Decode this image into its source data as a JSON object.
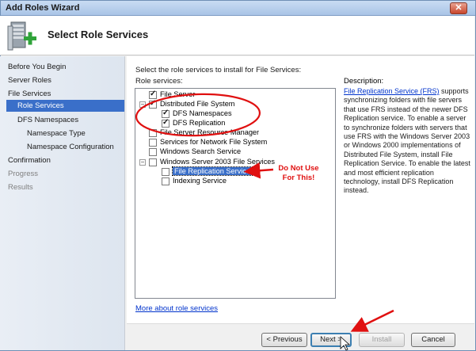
{
  "window": {
    "title": "Add Roles Wizard",
    "close_glyph": "✕"
  },
  "header": {
    "title": "Select Role Services",
    "icon": "server-role-add-icon"
  },
  "sidebar": {
    "items": [
      {
        "label": "Before You Begin"
      },
      {
        "label": "Server Roles"
      },
      {
        "label": "File Services"
      },
      {
        "label": "Role Services",
        "active": true
      },
      {
        "label": "DFS Namespaces"
      },
      {
        "label": "Namespace Type"
      },
      {
        "label": "Namespace Configuration"
      },
      {
        "label": "Confirmation"
      },
      {
        "label": "Progress",
        "disabled": true
      },
      {
        "label": "Results",
        "disabled": true
      }
    ]
  },
  "main": {
    "instruction": "Select the role services to install for File Services:",
    "list_label": "Role services:",
    "tree": [
      {
        "label": "File Server",
        "checked": true
      },
      {
        "label": "Distributed File System",
        "checked": true,
        "expander": "−"
      },
      {
        "label": "DFS Namespaces",
        "checked": true
      },
      {
        "label": "DFS Replication",
        "checked": true
      },
      {
        "label": "File Server Resource Manager",
        "checked": false
      },
      {
        "label": "Services for Network File System",
        "checked": false
      },
      {
        "label": "Windows Search Service",
        "checked": false
      },
      {
        "label": "Windows Server 2003 File Services",
        "checked": false,
        "expander": "−"
      },
      {
        "label": "File Replication Service",
        "checked": false,
        "selected": true
      },
      {
        "label": "Indexing Service",
        "checked": false
      }
    ],
    "description": {
      "title": "Description:",
      "link_text": "File Replication Service (FRS)",
      "body": " supports synchronizing folders with file servers that use FRS instead of the newer DFS Replication service. To enable a server to synchronize folders with servers that use FRS with the Windows Server 2003 or Windows 2000 implementations of Distributed File System, install File Replication Service. To enable the latest and most efficient replication technology, install DFS Replication instead."
    },
    "more_link": "More about role services",
    "annotation": "Do Not Use For This!"
  },
  "footer": {
    "previous": "< Previous",
    "next": "Next >",
    "install": "Install",
    "cancel": "Cancel"
  },
  "colors": {
    "accent": "#3a6fc9",
    "annotation": "#e01010",
    "link": "#0033cc"
  }
}
